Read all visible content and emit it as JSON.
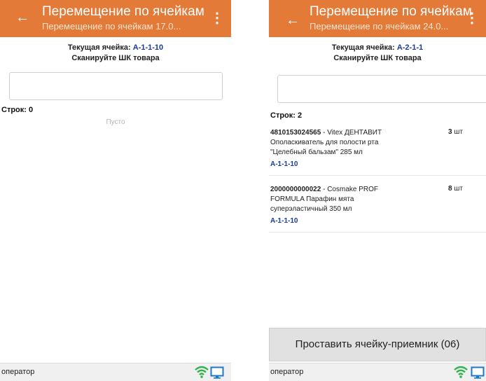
{
  "screens": [
    {
      "title": "Перемещение по ячейкам",
      "subtitle": "Перемещение по ячейкам 17.0...",
      "current_cell_label": "Текущая ячейка:",
      "current_cell_value": "А-1-1-10",
      "instruction": "Сканируйте ШК товара",
      "rows_label": "Строк: 0",
      "empty_text": "Пусто",
      "status_user": "оператор"
    },
    {
      "title": "Перемещение по ячейкам",
      "subtitle": "Перемещение по ячейкам 24.0...",
      "current_cell_label": "Текущая ячейка:",
      "current_cell_value": "А-2-1-1",
      "instruction": "Сканируйте ШК товара",
      "rows_label": "Строк: 2",
      "items": [
        {
          "code": "4810153024565",
          "name_line1": " - Vitex ДЕНТАВИТ",
          "name_line2": "Ополаскиватель для полости рта",
          "name_line3": "\"Целебный бальзам\" 285 мл",
          "cell": "А-1-1-10",
          "qty": "3",
          "unit": "шт"
        },
        {
          "code": "2000000000022",
          "name_line1": " - Cosmake PROF",
          "name_line2": "FORMULA Парафин мята",
          "name_line3": "суперэластичный 350 мл",
          "cell": "А-1-1-10",
          "qty": "8",
          "unit": "шт"
        }
      ],
      "action_button": "Проставить ячейку-приемник (06)",
      "status_user": "оператор"
    }
  ],
  "icons": {
    "back": "back-arrow-icon",
    "more": "more-vertical-icon",
    "wifi": "wifi-icon",
    "monitor": "monitor-icon"
  },
  "colors": {
    "appbar": "#e37a38",
    "cell_link": "#1a3a9a",
    "wifi": "#2fb34f",
    "monitor": "#1e78c8"
  }
}
